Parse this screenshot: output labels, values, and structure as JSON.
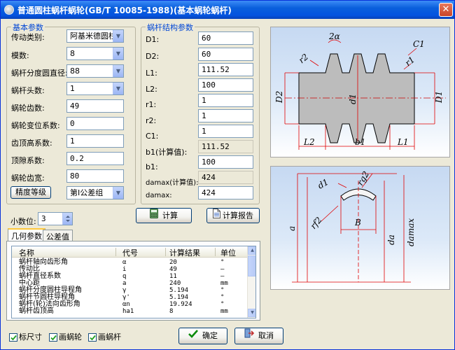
{
  "window": {
    "title": "普通圆柱蜗杆蜗轮(GB/T 10085-1988)(基本蜗轮蜗杆)",
    "close": "✕"
  },
  "basic_params": {
    "title": "基本参数",
    "drive_type": {
      "label": "传动类别:",
      "value": "阿基米德圆柱"
    },
    "module": {
      "label": "模数:",
      "value": "8"
    },
    "worm_ref_diameter": {
      "label": "蜗杆分度圆直径:",
      "value": "88"
    },
    "worm_starts": {
      "label": "蜗杆头数:",
      "value": "1"
    },
    "wheel_teeth": {
      "label": "蜗轮齿数:",
      "value": "49"
    },
    "wheel_shift_coef": {
      "label": "蜗轮变位系数:",
      "value": "0"
    },
    "addendum_coef": {
      "label": "齿顶高系数:",
      "value": "1"
    },
    "clearance_coef": {
      "label": "顶隙系数:",
      "value": "0.2"
    },
    "wheel_face_width": {
      "label": "蜗轮齿宽:",
      "value": "80"
    },
    "precision_button": "精度等级",
    "precision_group": "第Ⅰ公差组"
  },
  "worm_struct_params": {
    "title": "蜗杆结构参数",
    "fields": [
      {
        "label": "D1:",
        "value": "60"
      },
      {
        "label": "D2:",
        "value": "60"
      },
      {
        "label": "L1:",
        "value": "111.52"
      },
      {
        "label": "L2:",
        "value": "100"
      },
      {
        "label": "r1:",
        "value": "1"
      },
      {
        "label": "r2:",
        "value": "1"
      },
      {
        "label": "C1:",
        "value": "1"
      },
      {
        "label": "b1(计算值):",
        "value": "111.52"
      },
      {
        "label": "b1:",
        "value": "100"
      },
      {
        "label": "damax(计算值):",
        "value": "424"
      },
      {
        "label": "damax:",
        "value": "424"
      }
    ]
  },
  "decimal": {
    "label": "小数位:",
    "value": "3"
  },
  "buttons": {
    "calculate": "计算",
    "report": "计算报告",
    "ok": "确定",
    "cancel": "取消"
  },
  "tabs": [
    "几何参数",
    "公差值"
  ],
  "table": {
    "headers": [
      "名称",
      "代号",
      "计算结果",
      "单位"
    ],
    "rows": [
      [
        "蜗杆轴向齿形角",
        "α",
        "20",
        "°"
      ],
      [
        "传动比",
        "i",
        "49",
        "—"
      ],
      [
        "蜗杆直径系数",
        "q",
        "11",
        "—"
      ],
      [
        "中心距",
        "a",
        "240",
        "mm"
      ],
      [
        "蜗杆分度圆柱导程角",
        "γ",
        "5.194",
        "°"
      ],
      [
        "蜗杆节圆柱导程角",
        "γ'",
        "5.194",
        "°"
      ],
      [
        "蜗杆(轮)法向齿形角",
        "αn",
        "19.924",
        "°"
      ],
      [
        "蜗杆齿顶高",
        "ha1",
        "8",
        "mm"
      ]
    ]
  },
  "checkboxes": [
    {
      "label": "标尺寸",
      "checked": true
    },
    {
      "label": "画蜗轮",
      "checked": true
    },
    {
      "label": "画蜗杆",
      "checked": true
    }
  ],
  "worm_drawing_labels": {
    "two_alpha": "2α",
    "c1": "C1",
    "r2": "r2",
    "r1": "r1",
    "d2_cap": "D2",
    "d1": "d1",
    "d1_cap": "D1",
    "l2": "L2",
    "b1": "b1",
    "l1": "L1"
  },
  "wheel_drawing_labels": {
    "d1": "d1",
    "rg2": "rg2",
    "rf2": "rf2",
    "b": "B",
    "a": "a",
    "da": "da",
    "damax": "damax"
  },
  "colors": {
    "accent": "#0046d5",
    "dim_red": "#e00000",
    "drawing_bg": "#c6d9f2"
  }
}
